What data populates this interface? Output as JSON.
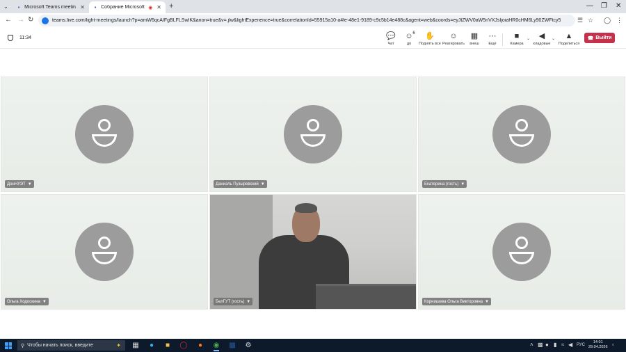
{
  "browser": {
    "tabs": [
      {
        "title": "Microsoft Teams meeting | Micr",
        "active": false
      },
      {
        "title": "Собрание Microsoft Teams",
        "active": true
      }
    ],
    "url_domain": "teams.live.com",
    "url_rest": "/light-meetings/launch?p=amW6qcAIFgBLFLSwIK&anon=true&v=.jlw&lightExperience=true&correlationId=55915a10-a4fe-48e1-9189-c9c5b14e488c&agent=web&coords=eyJtZWV0aW5nVXJsIjoiaHR0cHM6Ly90ZWFtcy5"
  },
  "meeting": {
    "time": "11:34",
    "toolbar": [
      {
        "label": "Чат",
        "icon": "chat-icon"
      },
      {
        "label": "до",
        "icon": "people-icon",
        "count": "6"
      },
      {
        "label": "Поднять все",
        "icon": "raise-hand-icon"
      },
      {
        "label": "Реагировать",
        "icon": "emoji-icon"
      },
      {
        "label": "внеш",
        "icon": "view-grid-icon"
      },
      {
        "label": "Ещё",
        "icon": "more-icon"
      },
      {
        "label": "Камера",
        "icon": "camera-off-icon"
      },
      {
        "label": "кладовые",
        "icon": "mic-off-icon"
      },
      {
        "label": "Поделиться",
        "icon": "share-icon"
      }
    ],
    "leave_label": "Выйти",
    "participants": [
      {
        "name": "ДонНУЭТ"
      },
      {
        "name": "Даниэль Пузыревский"
      },
      {
        "name": "Екатерина (гость)"
      },
      {
        "name": "Ольга Ходоскина"
      },
      {
        "name": "БелГУТ (гость)"
      },
      {
        "name": "Корнишева Ольга Викторовна"
      }
    ]
  },
  "taskbar": {
    "search_placeholder": "Чтобы начать поиск, введите",
    "lang": "РУС",
    "time": "14:01",
    "date": "29.04.2026"
  }
}
